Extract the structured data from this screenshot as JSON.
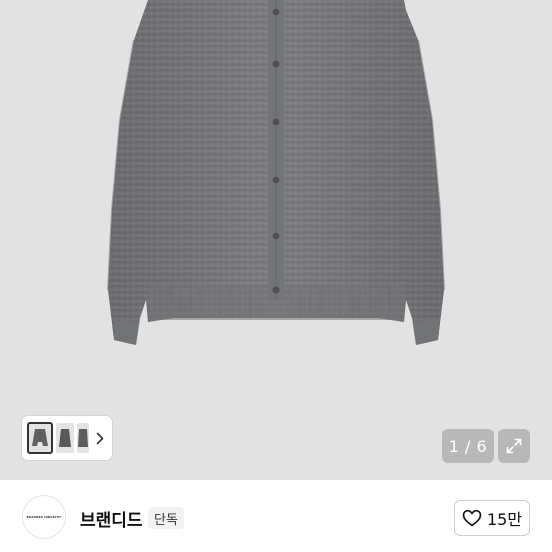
{
  "gallery": {
    "product_image": "gray-knit-cardigan-photo",
    "counter": "1 / 6",
    "thumbnail_count": 3,
    "icons": {
      "next": "chevron-right-icon",
      "expand": "expand-icon"
    }
  },
  "seller": {
    "logo_text": "BRANDED INDUSTRY",
    "name": "브랜디드",
    "badge": "단독"
  },
  "like": {
    "icon": "heart-outline-icon",
    "count": "15만"
  },
  "colors": {
    "background": "#e1e1e1",
    "sweater": "#7a7b7d",
    "overlay": "#9a9a9a",
    "text": "#111111"
  }
}
